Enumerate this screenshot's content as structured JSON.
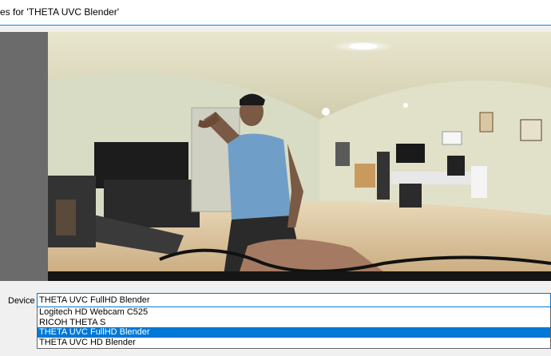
{
  "window": {
    "title": "es for 'THETA UVC Blender'"
  },
  "device": {
    "label": "Device",
    "selected_value": "THETA UVC FullHD Blender",
    "options": [
      "Logitech HD Webcam C525",
      "RICOH THETA S",
      "THETA UVC FullHD Blender",
      "THETA UVC HD Blender"
    ],
    "highlighted_option": "THETA UVC FullHD Blender"
  },
  "preview": {
    "icon": "camera-preview-image"
  },
  "colors": {
    "accent": "#0078d7",
    "title_border": "#1883d7",
    "preview_left_strip": "#6b6b6b"
  }
}
